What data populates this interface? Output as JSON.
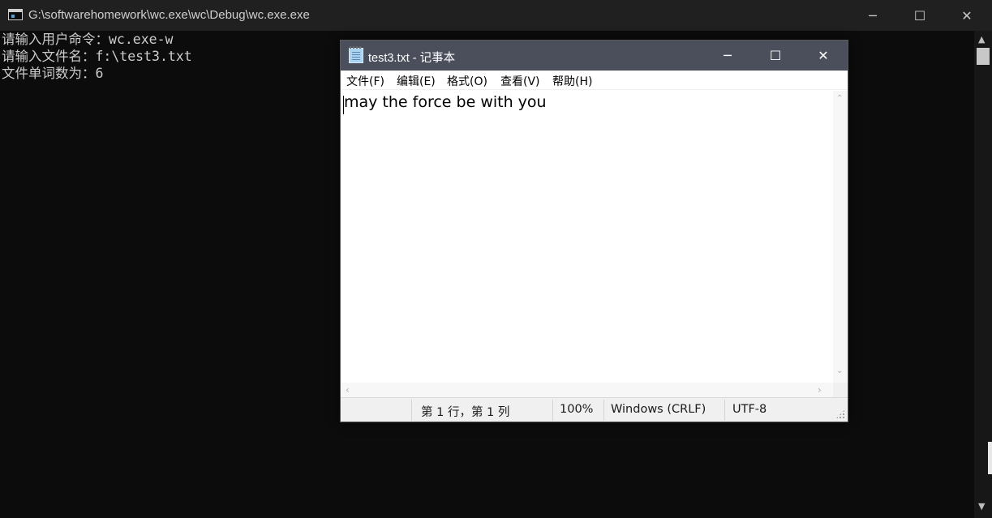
{
  "console": {
    "title": "G:\\softwarehomework\\wc.exe\\wc\\Debug\\wc.exe.exe",
    "controls": {
      "minimize": "─",
      "maximize": "☐",
      "close": "✕"
    },
    "lines": [
      "请输入用户命令：wc.exe-w",
      "请输入文件名：f:\\test3.txt",
      "文件单词数为：6"
    ],
    "scrollbar": {
      "up": "▲",
      "down": "▼"
    }
  },
  "notepad": {
    "title": "test3.txt - 记事本",
    "controls": {
      "minimize": "─",
      "maximize": "☐",
      "close": "✕"
    },
    "menu": [
      "文件(F)",
      "编辑(E)",
      "格式(O)",
      "查看(V)",
      "帮助(H)"
    ],
    "content": "may the force be with you",
    "scroll": {
      "up": "⌃",
      "down": "⌄",
      "left": "‹",
      "right": "›"
    },
    "status": {
      "position": "第 1 行，第 1 列",
      "zoom": "100%",
      "line_ending": "Windows (CRLF)",
      "encoding": "UTF-8"
    }
  }
}
